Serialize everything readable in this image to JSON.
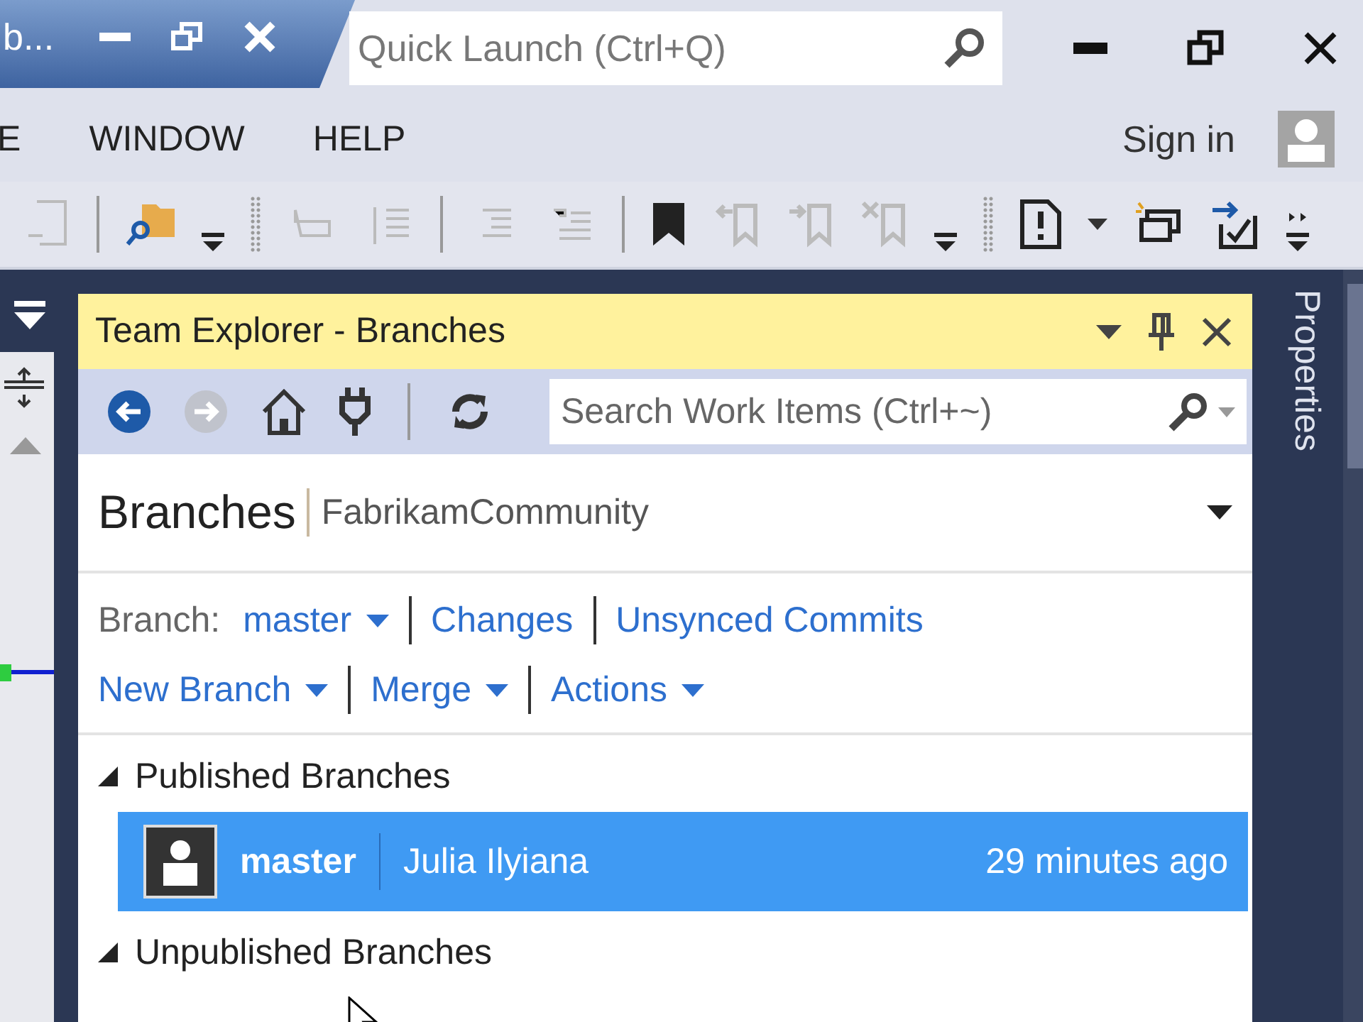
{
  "title_tab": {
    "title": "b..."
  },
  "quick_launch": {
    "placeholder": "Quick Launch (Ctrl+Q)"
  },
  "menu": [
    "E",
    "WINDOW",
    "HELP"
  ],
  "sign_in": "Sign in",
  "team_explorer": {
    "title": "Team Explorer - Branches",
    "nav": [
      {
        "kind": "back",
        "disabled": false
      },
      {
        "kind": "forward",
        "disabled": true
      },
      {
        "kind": "home",
        "disabled": false
      },
      {
        "kind": "connect",
        "disabled": false
      },
      {
        "kind": "refresh",
        "disabled": false
      }
    ],
    "search": {
      "placeholder": "Search Work Items (Ctrl+~)"
    },
    "heading": "Branches",
    "project": "FabrikamCommunity",
    "branch_label": "Branch:",
    "row_1": [
      {
        "label": "master",
        "dropdown": true
      },
      {
        "label": "Changes",
        "dropdown": false
      },
      {
        "label": "Unsynced Commits",
        "dropdown": false
      }
    ],
    "row_2": [
      {
        "label": "New Branch",
        "dropdown": true
      },
      {
        "label": "Merge",
        "dropdown": true
      },
      {
        "label": "Actions",
        "dropdown": true
      }
    ],
    "sections": [
      {
        "title": "Published Branches",
        "expanded": true,
        "branches": [
          {
            "name": "master",
            "author": "Julia Ilyiana",
            "time": "29 minutes ago",
            "selected": true
          }
        ]
      },
      {
        "title": "Unpublished Branches",
        "expanded": true
      }
    ]
  },
  "properties_tab": "Properties"
}
